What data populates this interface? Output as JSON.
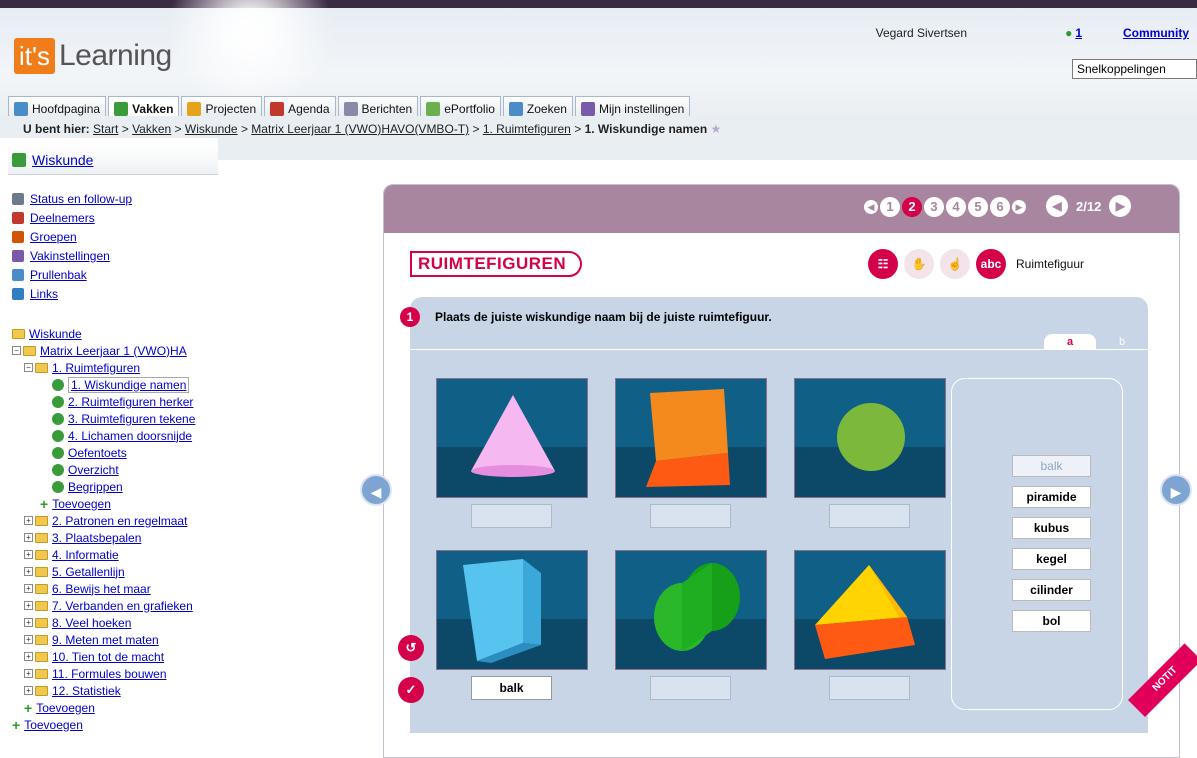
{
  "header": {
    "logo_box": "it's",
    "logo_text": "Learning",
    "user_name": "Vegard Sivertsen",
    "online_count": "1",
    "community": "Community",
    "quicklinks": "Snelkoppelingen"
  },
  "tabs": [
    {
      "label": "Hoofdpagina",
      "icon_color": "#4a8bc9"
    },
    {
      "label": "Vakken",
      "icon_color": "#3a9b3a"
    },
    {
      "label": "Projecten",
      "icon_color": "#e4a31b"
    },
    {
      "label": "Agenda",
      "icon_color": "#c0392b"
    },
    {
      "label": "Berichten",
      "icon_color": "#8a8aa8"
    },
    {
      "label": "ePortfolio",
      "icon_color": "#6ab04c"
    },
    {
      "label": "Zoeken",
      "icon_color": "#4a8bc9"
    },
    {
      "label": "Mijn instellingen",
      "icon_color": "#7a5aa8"
    }
  ],
  "breadcrumb": {
    "prefix": "U bent hier:",
    "items": [
      "Start",
      "Vakken",
      "Wiskunde",
      "Matrix Leerjaar 1 (VWO)HAVO(VMBO-T)",
      "1. Ruimtefiguren"
    ],
    "current": "1. Wiskundige namen",
    "sep": ">"
  },
  "course": {
    "title": "Wiskunde"
  },
  "menu": [
    {
      "label": "Status en follow-up",
      "icon": "status-icon",
      "color": "#6b7b8b"
    },
    {
      "label": "Deelnemers",
      "icon": "people-icon",
      "color": "#c0392b"
    },
    {
      "label": "Groepen",
      "icon": "groups-icon",
      "color": "#d35400"
    },
    {
      "label": "Vakinstellingen",
      "icon": "settings-icon",
      "color": "#7a5aa8"
    },
    {
      "label": "Prullenbak",
      "icon": "trash-icon",
      "color": "#4a8bc9"
    },
    {
      "label": "Links",
      "icon": "globe-icon",
      "color": "#2f7ec1"
    }
  ],
  "tree": {
    "root": "Wiskunde",
    "matrix": "Matrix Leerjaar 1 (VWO)HA",
    "ruimte": "1. Ruimtefiguren",
    "pages": [
      "1. Wiskundige namen",
      "2. Ruimtefiguren herker",
      "3. Ruimtefiguren tekene",
      "4. Lichamen doorsnijde",
      "Oefentoets",
      "Overzicht",
      "Begrippen"
    ],
    "add": "Toevoegen",
    "chapters": [
      "2. Patronen en regelmaat",
      "3. Plaatsbepalen",
      "4. Informatie",
      "5. Getallenlijn",
      "6. Bewijs het maar",
      "7. Verbanden en grafieken",
      "8. Veel hoeken",
      "9. Meten met maten",
      "10. Tien tot de macht",
      "11. Formules bouwen",
      "12. Statistiek"
    ],
    "add2": "Toevoegen",
    "add3": "Toevoegen"
  },
  "panel": {
    "pages": [
      "1",
      "2",
      "3",
      "4",
      "5",
      "6"
    ],
    "current_page": "2",
    "counter": "2/12",
    "title": "RUIMTEFIGUREN",
    "icon_label": "Ruimtefiguur",
    "abc": "abc",
    "instruction_num": "1",
    "instruction": "Plaats de juiste wiskundige naam bij de juiste ruimtefiguur.",
    "tab_a": "a",
    "tab_b": "b",
    "slot_filled": "balk",
    "words": [
      "balk",
      "piramide",
      "kubus",
      "kegel",
      "cilinder",
      "bol"
    ],
    "notes": "NOTIT"
  }
}
